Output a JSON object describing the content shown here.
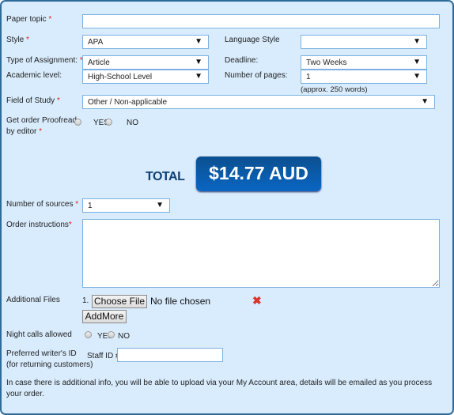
{
  "paper_topic": {
    "label": "Paper topic",
    "value": ""
  },
  "style": {
    "label": "Style",
    "value": "APA"
  },
  "language_style": {
    "label": "Language Style",
    "value": ""
  },
  "type_of_assignment": {
    "label": "Type of Assignment:",
    "value": "Article"
  },
  "deadline": {
    "label": "Deadline:",
    "value": "Two Weeks"
  },
  "academic_level": {
    "label": "Academic level:",
    "value": "High-School Level"
  },
  "number_of_pages": {
    "label": "Number of pages:",
    "value": "1",
    "hint": "(approx. 250 words)"
  },
  "field_of_study": {
    "label": "Field of Study",
    "value": "Other / Non-applicable"
  },
  "proofread": {
    "label_line1": "Get order Proofread",
    "label_line2": "by editor",
    "yes": "YES",
    "no": "NO"
  },
  "total": {
    "label": "TOTAL",
    "value": "$14.77 AUD"
  },
  "number_of_sources": {
    "label": "Number of sources",
    "value": "1"
  },
  "order_instructions": {
    "label": "Order instructions",
    "value": ""
  },
  "additional_files": {
    "label": "Additional Files",
    "index": "1.",
    "choose_file": "Choose File",
    "status": "No file chosen",
    "add_more": "AddMore"
  },
  "night_calls": {
    "label": "Night calls allowed",
    "yes": "YES",
    "no": "NO"
  },
  "preferred_writer": {
    "label_line1": "Preferred writer's ID",
    "label_line2": "(for returning customers)",
    "staff_label": "Staff ID #",
    "value": ""
  },
  "info_text": "In case there is additional info, you will be able to upload via your My Account area, details will be emailed as you process your order.",
  "required_mark": "*",
  "arrow": "▼",
  "colors": {
    "accent": "#0a5ca8",
    "required": "#e0201a",
    "background": "#d9ecfd"
  }
}
